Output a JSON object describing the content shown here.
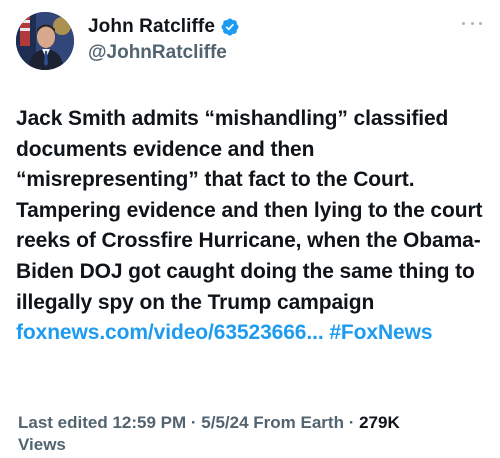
{
  "author": {
    "display_name": "John Ratcliffe",
    "handle": "@JohnRatcliffe",
    "avatar_icon": "profile-photo",
    "verified_icon": "verified-badge-icon",
    "verified_color": "#1d9bf0"
  },
  "tweet": {
    "text_segments": [
      "Jack Smith admits “mishandling” classified documents evidence and then “misrepresenting” that fact to the Court. Tampering evidence and then lying to the court reeks of Crossfire Hurricane, when the Obama-Biden DOJ got caught doing the same thing to illegally spy on the Trump campaign "
    ],
    "link_text": "foxnews.com/video/63523666...",
    "separator": " ",
    "hashtag": "#FoxNews",
    "link_color": "#1d9bf0"
  },
  "meta": {
    "edited_label": "Last edited 12:59 PM · 5/5/24",
    "source": "From Earth",
    "dot": " · ",
    "views_count": "279K",
    "views_label": "Views"
  },
  "menu": {
    "more_icon": "more-horizontal-icon"
  }
}
